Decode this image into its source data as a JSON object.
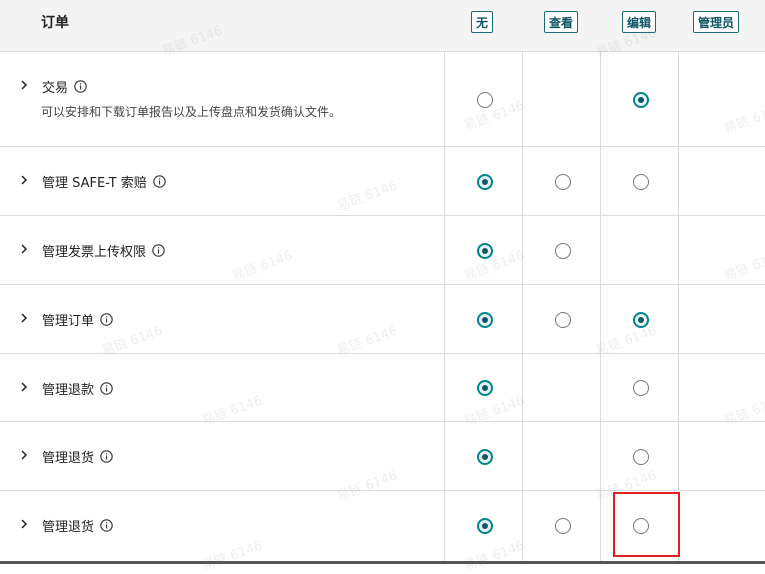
{
  "header": {
    "title": "订单",
    "columns": [
      "无",
      "查看",
      "编辑",
      "管理员"
    ]
  },
  "rows": [
    {
      "label": "交易",
      "description": "可以安排和下载订单报告以及上传盘点和发货确认文件。",
      "options": {
        "none": "unchecked",
        "view": null,
        "edit": "checked"
      }
    },
    {
      "label": "管理 SAFE-T 索赔",
      "options": {
        "none": "checked",
        "view": "unchecked",
        "edit": "unchecked"
      }
    },
    {
      "label": "管理发票上传权限",
      "options": {
        "none": "checked",
        "view": "unchecked",
        "edit": null
      }
    },
    {
      "label": "管理订单",
      "options": {
        "none": "checked",
        "view": "unchecked",
        "edit": "checked"
      }
    },
    {
      "label": "管理退款",
      "options": {
        "none": "checked",
        "view": null,
        "edit": "unchecked"
      }
    },
    {
      "label": "管理退货",
      "options": {
        "none": "checked",
        "view": null,
        "edit": "unchecked"
      }
    },
    {
      "label": "管理退货",
      "options": {
        "none": "checked",
        "view": "unchecked",
        "edit": "unchecked"
      }
    }
  ],
  "watermark_text": "易链 6146",
  "colors": {
    "accent": "#00838f",
    "highlight": "#e02020"
  }
}
